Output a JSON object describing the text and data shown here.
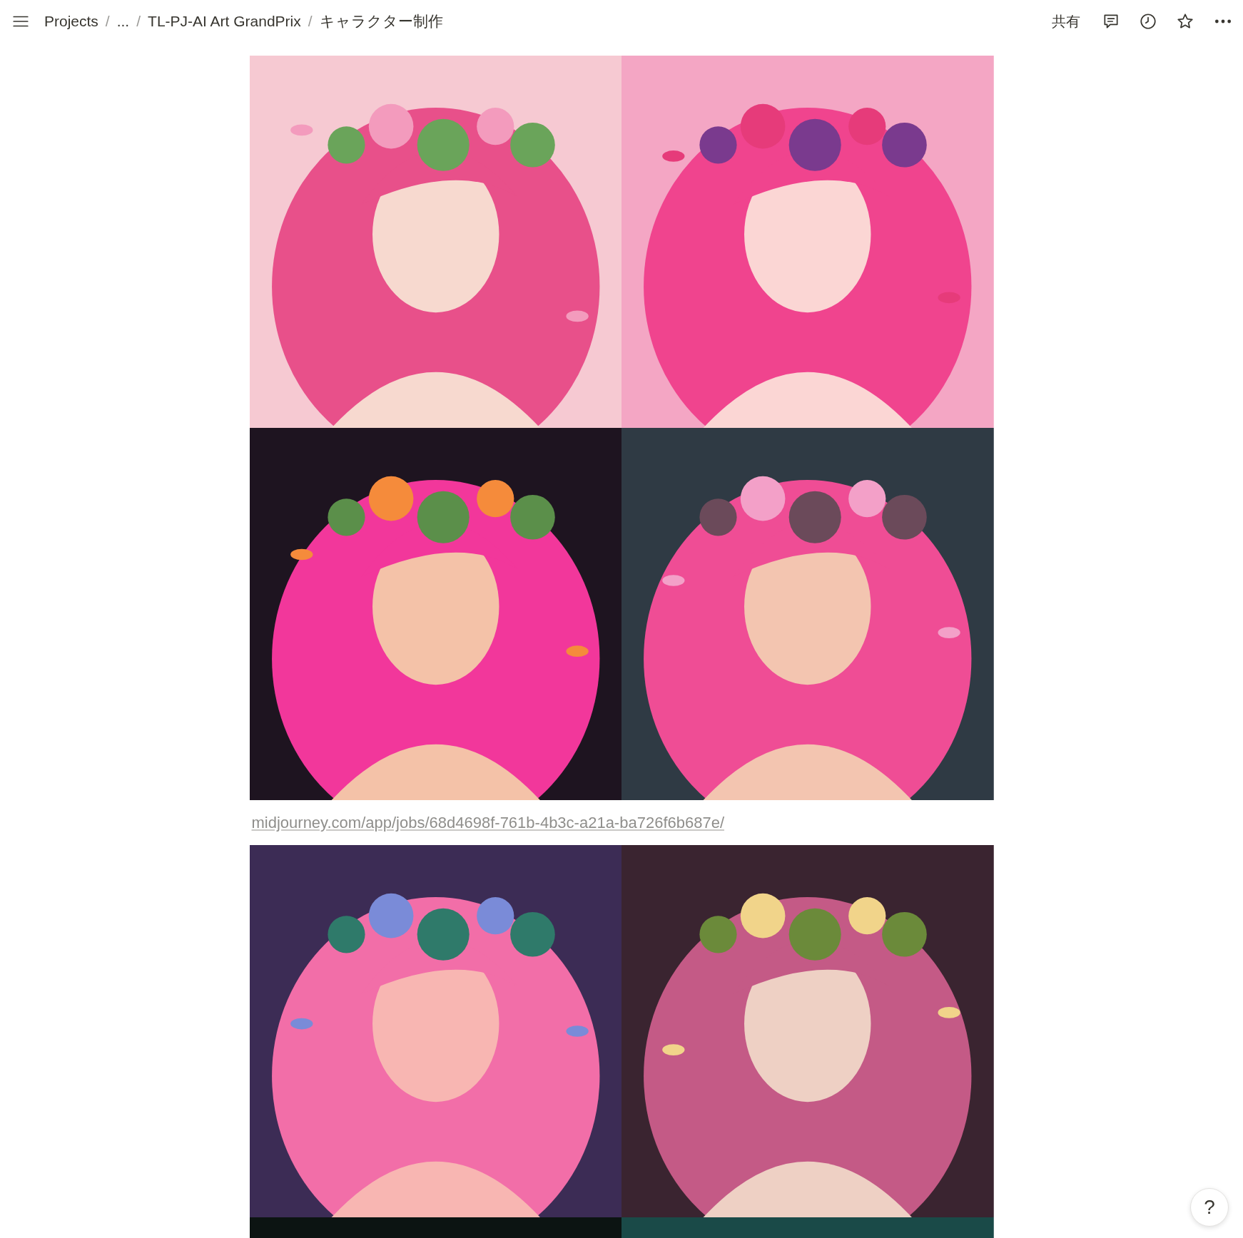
{
  "topbar": {
    "breadcrumb": [
      {
        "kind": "link",
        "text": "Projects"
      },
      {
        "kind": "separator",
        "text": "/"
      },
      {
        "kind": "link",
        "text": "..."
      },
      {
        "kind": "separator",
        "text": "/"
      },
      {
        "kind": "link",
        "text": "TL-PJ-AI Art GrandPrix"
      },
      {
        "kind": "separator",
        "text": "/"
      },
      {
        "kind": "link",
        "text": "キャラクター制作"
      }
    ],
    "share": "共有"
  },
  "blocks": [
    {
      "kind": "gallery"
    },
    {
      "kind": "link",
      "text": "midjourney.com/app/jobs/68d4698f-761b-4b3c-a21a-ba726f6b687e/"
    },
    {
      "kind": "gallery"
    }
  ],
  "help": "?"
}
